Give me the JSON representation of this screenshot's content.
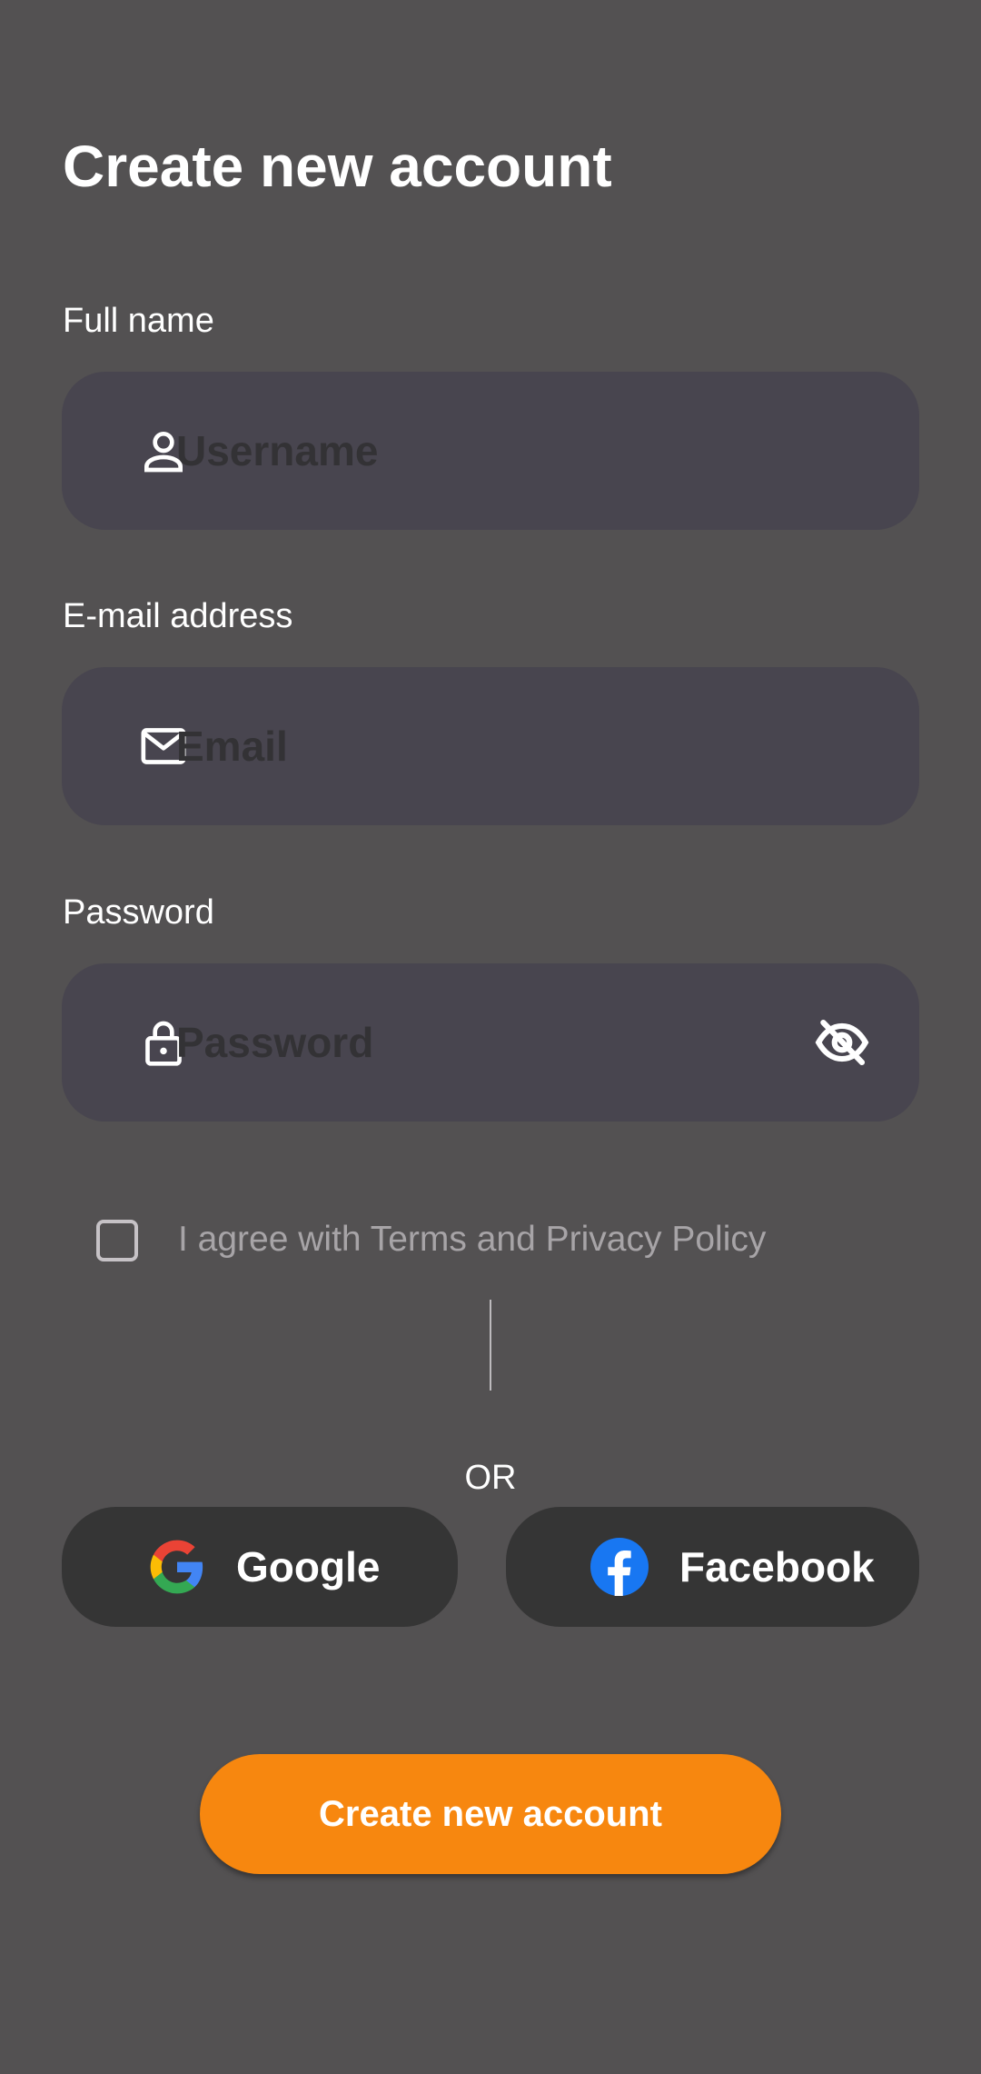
{
  "title": "Create new account",
  "form": {
    "fullname_label": "Full name",
    "username_placeholder": "Username",
    "email_label": "E-mail address",
    "email_placeholder": "Email",
    "password_label": "Password",
    "password_placeholder": "Password",
    "agree_text": "I agree with Terms and Privacy Policy",
    "agree_checked": false
  },
  "social": {
    "or_text": "OR",
    "google_label": "Google",
    "facebook_label": "Facebook"
  },
  "submit_label": "Create new account",
  "icons": {
    "username": "person-icon",
    "email": "mail-icon",
    "password": "lock-icon",
    "visibility": "eye-off-icon",
    "google": "google-logo",
    "facebook": "facebook-logo"
  },
  "colors": {
    "background": "#535152",
    "field": "#48454f",
    "social_button": "#353535",
    "accent": "#f7870f",
    "facebook_blue": "#1877f2"
  }
}
